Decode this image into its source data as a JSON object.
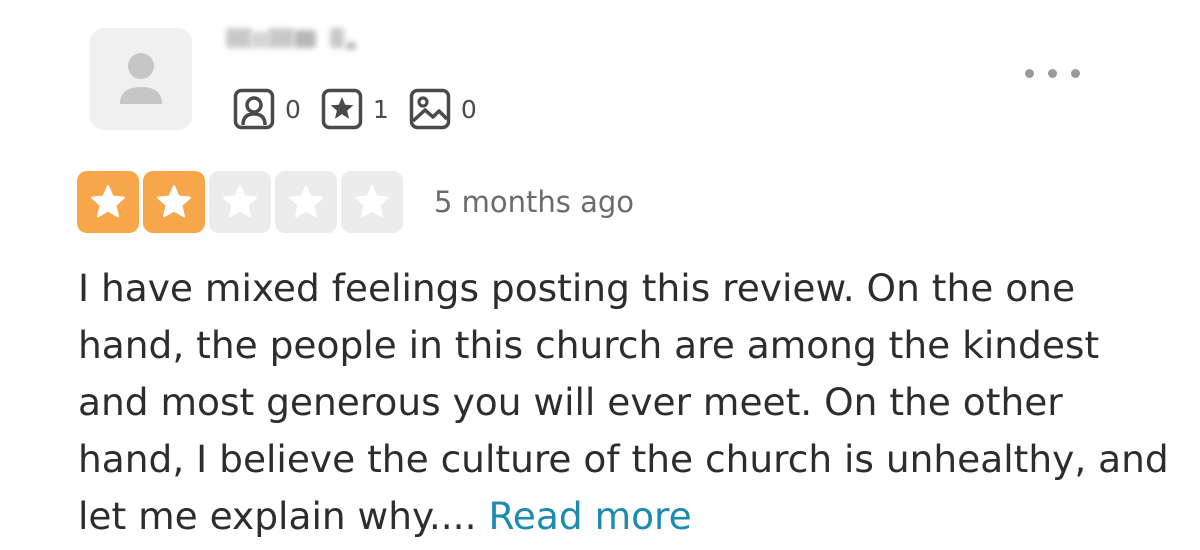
{
  "review": {
    "author": {
      "name": "",
      "name_redacted": true,
      "avatar_icon": "default-user-avatar-icon"
    },
    "stats": [
      {
        "icon": "friends-icon",
        "count": "0"
      },
      {
        "icon": "reviews-star-icon",
        "count": "1"
      },
      {
        "icon": "photos-icon",
        "count": "0"
      }
    ],
    "menu_icon": "more-options-icon",
    "rating": 2,
    "rating_max": 5,
    "time_ago": "5 months ago",
    "text": "I have mixed feelings posting this review. On the one hand, the people in this church are among the kindest and most generous you will ever meet. On the other hand, I believe the culture of the church is unhealthy, and let me explain why....",
    "read_more_label": "Read more"
  },
  "colors": {
    "star_filled": "#f7a74a",
    "star_empty": "#ececec",
    "link": "#1c8bb0",
    "text": "#2d2d2d"
  }
}
